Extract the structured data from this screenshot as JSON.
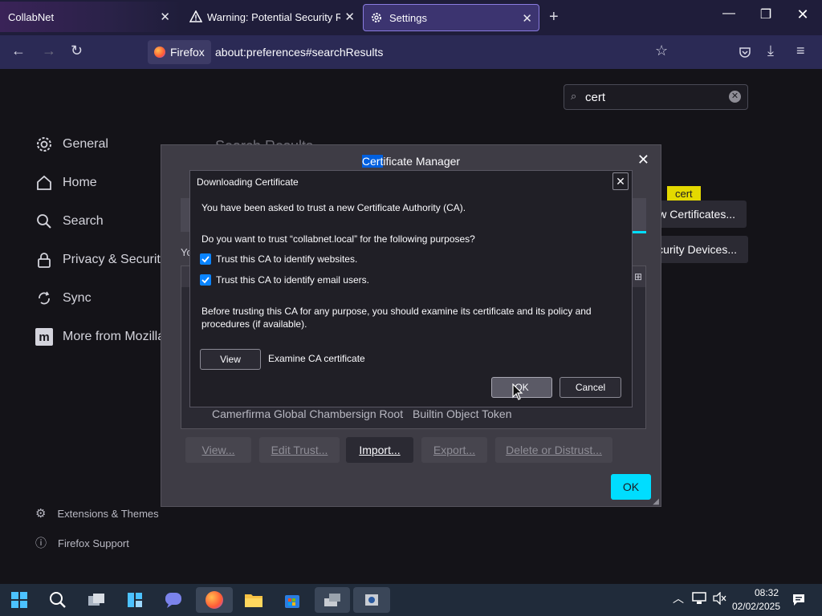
{
  "tabs": [
    {
      "label": "CollabNet"
    },
    {
      "label": "Warning: Potential Security Risk"
    },
    {
      "label": "Settings"
    }
  ],
  "nav": {
    "identity": "Firefox",
    "url": "about:preferences#searchResults"
  },
  "sidebar": {
    "items": [
      {
        "label": "General"
      },
      {
        "label": "Home"
      },
      {
        "label": "Search"
      },
      {
        "label": "Privacy & Security"
      },
      {
        "label": "Sync"
      },
      {
        "label": "More from Mozilla"
      }
    ],
    "footer": [
      {
        "label": "Extensions & Themes"
      },
      {
        "label": "Firefox Support"
      }
    ]
  },
  "search": {
    "value": "cert"
  },
  "bg": {
    "heading": "Search Results",
    "tooltip": "cert",
    "view_certs_btn": "View Certificates...",
    "sec_devices_btn": "Security Devices...",
    "partial_text": "You"
  },
  "cert_manager": {
    "title": "Certificate Manager",
    "title_highlight": "Cert",
    "title_rest": "ificate Manager",
    "row": {
      "name": "Camerfirma Global Chambersign Root",
      "token": "Builtin Object Token"
    },
    "buttons": {
      "view": "View...",
      "edit": "Edit Trust...",
      "import": "Import...",
      "export": "Export...",
      "delete": "Delete or Distrust..."
    },
    "ok": "OK"
  },
  "dialog": {
    "title": "Downloading Certificate",
    "intro": "You have been asked to trust a new Certificate Authority (CA).",
    "question": "Do you want to trust “collabnet.local” for the following purposes?",
    "cb1": "Trust this CA to identify websites.",
    "cb2": "Trust this CA to identify email users.",
    "warning": "Before trusting this CA for any purpose, you should examine its certificate and its policy and procedures (if available).",
    "view_btn": "View",
    "view_desc": "Examine CA certificate",
    "ok": "OK",
    "cancel": "Cancel"
  },
  "taskbar": {
    "time": "08:32",
    "date": "02/02/2025"
  }
}
